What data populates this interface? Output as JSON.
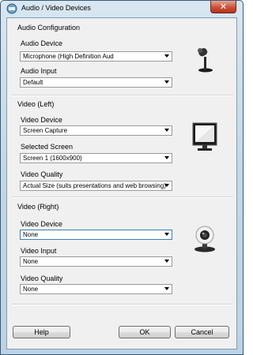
{
  "window": {
    "title": "Audio / Video Devices",
    "close_icon": "close-icon"
  },
  "audio": {
    "group_title": "Audio Configuration",
    "device_label": "Audio Device",
    "device_value": "Microphone (High Definition Aud",
    "input_label": "Audio Input",
    "input_value": "Default",
    "icon": "microphone-icon"
  },
  "video_left": {
    "group_title": "Video (Left)",
    "device_label": "Video Device",
    "device_value": "Screen Capture",
    "screen_label": "Selected Screen",
    "screen_value": "Screen 1 (1600x900)",
    "quality_label": "Video Quality",
    "quality_value": "Actual Size (suits presentations and web browsing)",
    "icon": "monitor-icon"
  },
  "video_right": {
    "group_title": "Video (Right)",
    "device_label": "Video Device",
    "device_value": "None",
    "input_label": "Video Input",
    "input_value": "None",
    "quality_label": "Video Quality",
    "quality_value": "None",
    "icon": "webcam-icon"
  },
  "buttons": {
    "help": "Help",
    "ok": "OK",
    "cancel": "Cancel"
  }
}
